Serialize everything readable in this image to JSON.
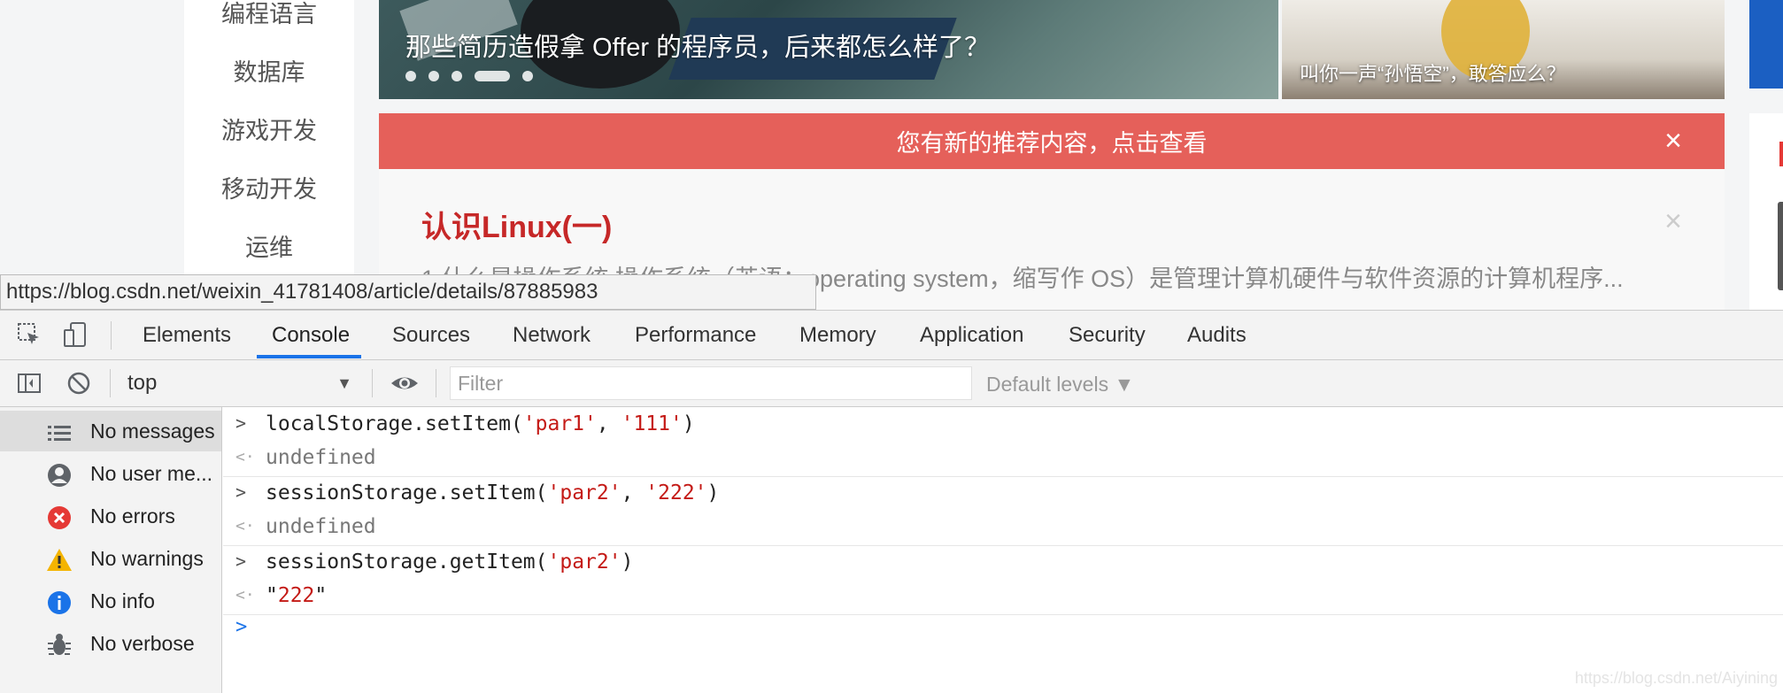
{
  "page": {
    "nav_items": [
      "编程语言",
      "数据库",
      "游戏开发",
      "移动开发",
      "运维"
    ],
    "banner_main_caption": "那些简历造假拿 Offer 的程序员，后来都怎么样了？",
    "banner_side_caption": "叫你一声“孙悟空”，敢答应么？",
    "notice_text": "您有新的推荐内容，点击查看",
    "notice_close": "×",
    "article_title": "认识Linux(一)",
    "article_close": "×",
    "article_desc": "1.什么是操作系统 操作系统（英语：operating system，缩写作 OS）是管理计算机硬件与软件资源的计算机程序...",
    "status_url": "https://blog.csdn.net/weixin_41781408/article/details/87885983"
  },
  "devtools": {
    "tabs": [
      "Elements",
      "Console",
      "Sources",
      "Network",
      "Performance",
      "Memory",
      "Application",
      "Security",
      "Audits"
    ],
    "active_tab": "Console",
    "context": "top",
    "context_caret": "▼",
    "filter_placeholder": "Filter",
    "levels": "Default levels ▼",
    "sidebar": [
      {
        "icon": "list-icon",
        "label": "No messages"
      },
      {
        "icon": "user-icon",
        "label": "No user me..."
      },
      {
        "icon": "error-icon",
        "label": "No errors"
      },
      {
        "icon": "warning-icon",
        "label": "No warnings"
      },
      {
        "icon": "info-icon",
        "label": "No info"
      },
      {
        "icon": "bug-icon",
        "label": "No verbose"
      }
    ],
    "console": {
      "cmd1_prefix": "localStorage.setItem(",
      "cmd1_arg1": "'par1'",
      "cmd1_sep": ", ",
      "cmd1_arg2": "'111'",
      "cmd1_suffix": ")",
      "res1": "undefined",
      "cmd2_prefix": "sessionStorage.setItem(",
      "cmd2_arg1": "'par2'",
      "cmd2_sep": ", ",
      "cmd2_arg2": "'222'",
      "cmd2_suffix": ")",
      "res2": "undefined",
      "cmd3_prefix": "sessionStorage.getItem(",
      "cmd3_arg1": "'par2'",
      "cmd3_suffix": ")",
      "res3_quote_open": "\"",
      "res3_value": "222",
      "res3_quote_close": "\""
    },
    "watermark": "https://blog.csdn.net/Aiyining"
  },
  "colors": {
    "notice_bg": "#e5605a",
    "article_title": "#c62828",
    "string_literal": "#c41a16",
    "active_tab_underline": "#1a73e8"
  }
}
